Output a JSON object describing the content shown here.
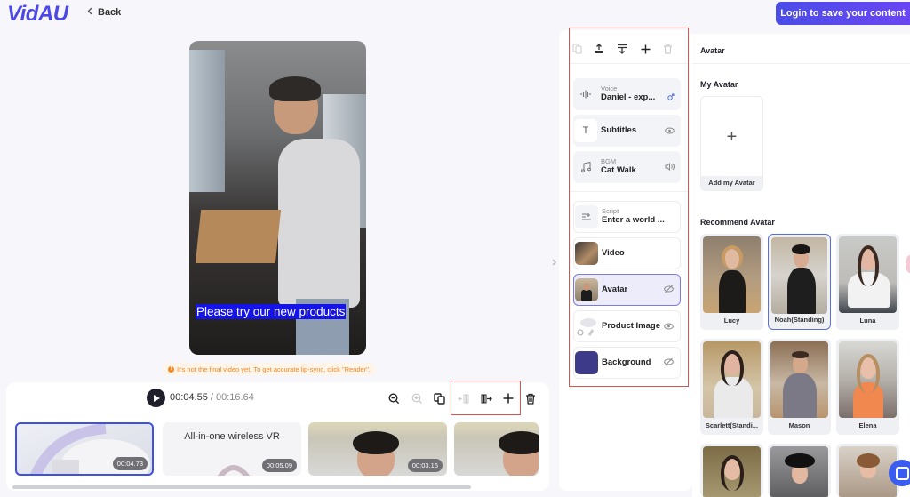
{
  "header": {
    "logo": "VidAU",
    "back_label": "Back",
    "login_label": "Login to save your content"
  },
  "preview": {
    "subtitle_text": "Please try our new products",
    "notice": "It's not the final video yet, To get accurate lip-sync, click \"Render\"."
  },
  "player": {
    "current_time": "00:04.55",
    "separator": " / ",
    "total_time": "00:16.64"
  },
  "timeline": {
    "clips": [
      {
        "label": "",
        "duration": "00:04.73",
        "selected": true
      },
      {
        "label": "All-in-one wireless VR",
        "duration": "00:05.09",
        "selected": false
      },
      {
        "label": "",
        "duration": "00:03.16",
        "selected": false
      },
      {
        "label": "",
        "duration": "",
        "selected": false
      }
    ]
  },
  "layers": {
    "items": [
      {
        "key": "voice",
        "small": "Voice",
        "label": "Daniel - exp...",
        "icon": "waveform-icon",
        "badge": "male-icon"
      },
      {
        "key": "subtitles",
        "label": "Subtitles",
        "icon": "text-icon",
        "badge": "eye-icon"
      },
      {
        "key": "bgm",
        "small": "BGM",
        "label": "Cat Walk",
        "icon": "music-icon",
        "badge": "volume-icon"
      },
      {
        "key": "script",
        "small": "Script",
        "label": "Enter a world ...",
        "icon": "script-icon"
      },
      {
        "key": "video",
        "label": "Video",
        "icon": "video-thumbnail"
      },
      {
        "key": "avatar",
        "label": "Avatar",
        "icon": "avatar-thumbnail",
        "badge": "eye-off-icon",
        "selected": true
      },
      {
        "key": "product-image",
        "label": "Product Image",
        "icon": "product-thumbnail",
        "badge": "eye-icon"
      },
      {
        "key": "background",
        "label": "Background",
        "icon": "color-swatch",
        "badge": "eye-off-icon",
        "color": "#3d3a8a"
      }
    ]
  },
  "avatar_panel": {
    "title": "Avatar",
    "my_avatar_heading": "My Avatar",
    "add_label": "Add my Avatar",
    "recommend_heading": "Recommend Avatar",
    "avatars": [
      {
        "name": "Lucy",
        "selected": false
      },
      {
        "name": "Noah(Standing)",
        "selected": true
      },
      {
        "name": "Luna",
        "selected": false
      },
      {
        "name": "Scarlett(Standi...",
        "selected": false
      },
      {
        "name": "Mason",
        "selected": false
      },
      {
        "name": "Elena",
        "selected": false
      },
      {
        "name": "",
        "selected": false
      },
      {
        "name": "",
        "selected": false
      },
      {
        "name": "",
        "selected": false
      }
    ]
  },
  "colors": {
    "brand": "#4b48e6",
    "accent": "#5b6ee0",
    "subtitle_bg": "#1414e8",
    "notice": "#f0892a",
    "highlight_box": "#d9534f"
  }
}
